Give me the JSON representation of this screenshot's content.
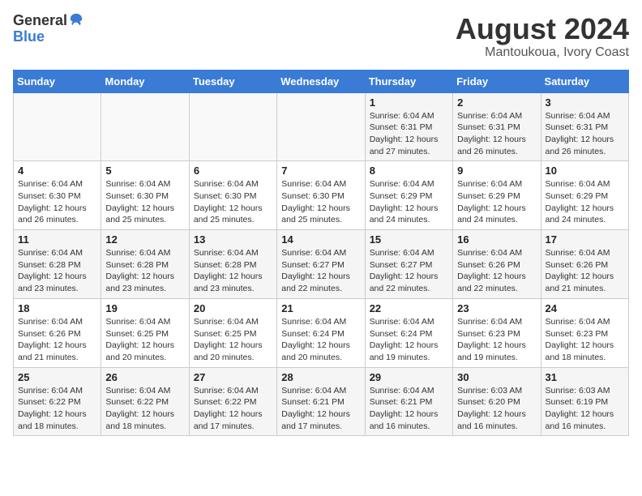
{
  "header": {
    "logo_general": "General",
    "logo_blue": "Blue",
    "month_year": "August 2024",
    "location": "Mantoukoua, Ivory Coast"
  },
  "days_of_week": [
    "Sunday",
    "Monday",
    "Tuesday",
    "Wednesday",
    "Thursday",
    "Friday",
    "Saturday"
  ],
  "weeks": [
    [
      {
        "day": "",
        "info": ""
      },
      {
        "day": "",
        "info": ""
      },
      {
        "day": "",
        "info": ""
      },
      {
        "day": "",
        "info": ""
      },
      {
        "day": "1",
        "info": "Sunrise: 6:04 AM\nSunset: 6:31 PM\nDaylight: 12 hours\nand 27 minutes."
      },
      {
        "day": "2",
        "info": "Sunrise: 6:04 AM\nSunset: 6:31 PM\nDaylight: 12 hours\nand 26 minutes."
      },
      {
        "day": "3",
        "info": "Sunrise: 6:04 AM\nSunset: 6:31 PM\nDaylight: 12 hours\nand 26 minutes."
      }
    ],
    [
      {
        "day": "4",
        "info": "Sunrise: 6:04 AM\nSunset: 6:30 PM\nDaylight: 12 hours\nand 26 minutes."
      },
      {
        "day": "5",
        "info": "Sunrise: 6:04 AM\nSunset: 6:30 PM\nDaylight: 12 hours\nand 25 minutes."
      },
      {
        "day": "6",
        "info": "Sunrise: 6:04 AM\nSunset: 6:30 PM\nDaylight: 12 hours\nand 25 minutes."
      },
      {
        "day": "7",
        "info": "Sunrise: 6:04 AM\nSunset: 6:30 PM\nDaylight: 12 hours\nand 25 minutes."
      },
      {
        "day": "8",
        "info": "Sunrise: 6:04 AM\nSunset: 6:29 PM\nDaylight: 12 hours\nand 24 minutes."
      },
      {
        "day": "9",
        "info": "Sunrise: 6:04 AM\nSunset: 6:29 PM\nDaylight: 12 hours\nand 24 minutes."
      },
      {
        "day": "10",
        "info": "Sunrise: 6:04 AM\nSunset: 6:29 PM\nDaylight: 12 hours\nand 24 minutes."
      }
    ],
    [
      {
        "day": "11",
        "info": "Sunrise: 6:04 AM\nSunset: 6:28 PM\nDaylight: 12 hours\nand 23 minutes."
      },
      {
        "day": "12",
        "info": "Sunrise: 6:04 AM\nSunset: 6:28 PM\nDaylight: 12 hours\nand 23 minutes."
      },
      {
        "day": "13",
        "info": "Sunrise: 6:04 AM\nSunset: 6:28 PM\nDaylight: 12 hours\nand 23 minutes."
      },
      {
        "day": "14",
        "info": "Sunrise: 6:04 AM\nSunset: 6:27 PM\nDaylight: 12 hours\nand 22 minutes."
      },
      {
        "day": "15",
        "info": "Sunrise: 6:04 AM\nSunset: 6:27 PM\nDaylight: 12 hours\nand 22 minutes."
      },
      {
        "day": "16",
        "info": "Sunrise: 6:04 AM\nSunset: 6:26 PM\nDaylight: 12 hours\nand 22 minutes."
      },
      {
        "day": "17",
        "info": "Sunrise: 6:04 AM\nSunset: 6:26 PM\nDaylight: 12 hours\nand 21 minutes."
      }
    ],
    [
      {
        "day": "18",
        "info": "Sunrise: 6:04 AM\nSunset: 6:26 PM\nDaylight: 12 hours\nand 21 minutes."
      },
      {
        "day": "19",
        "info": "Sunrise: 6:04 AM\nSunset: 6:25 PM\nDaylight: 12 hours\nand 20 minutes."
      },
      {
        "day": "20",
        "info": "Sunrise: 6:04 AM\nSunset: 6:25 PM\nDaylight: 12 hours\nand 20 minutes."
      },
      {
        "day": "21",
        "info": "Sunrise: 6:04 AM\nSunset: 6:24 PM\nDaylight: 12 hours\nand 20 minutes."
      },
      {
        "day": "22",
        "info": "Sunrise: 6:04 AM\nSunset: 6:24 PM\nDaylight: 12 hours\nand 19 minutes."
      },
      {
        "day": "23",
        "info": "Sunrise: 6:04 AM\nSunset: 6:23 PM\nDaylight: 12 hours\nand 19 minutes."
      },
      {
        "day": "24",
        "info": "Sunrise: 6:04 AM\nSunset: 6:23 PM\nDaylight: 12 hours\nand 18 minutes."
      }
    ],
    [
      {
        "day": "25",
        "info": "Sunrise: 6:04 AM\nSunset: 6:22 PM\nDaylight: 12 hours\nand 18 minutes."
      },
      {
        "day": "26",
        "info": "Sunrise: 6:04 AM\nSunset: 6:22 PM\nDaylight: 12 hours\nand 18 minutes."
      },
      {
        "day": "27",
        "info": "Sunrise: 6:04 AM\nSunset: 6:22 PM\nDaylight: 12 hours\nand 17 minutes."
      },
      {
        "day": "28",
        "info": "Sunrise: 6:04 AM\nSunset: 6:21 PM\nDaylight: 12 hours\nand 17 minutes."
      },
      {
        "day": "29",
        "info": "Sunrise: 6:04 AM\nSunset: 6:21 PM\nDaylight: 12 hours\nand 16 minutes."
      },
      {
        "day": "30",
        "info": "Sunrise: 6:03 AM\nSunset: 6:20 PM\nDaylight: 12 hours\nand 16 minutes."
      },
      {
        "day": "31",
        "info": "Sunrise: 6:03 AM\nSunset: 6:19 PM\nDaylight: 12 hours\nand 16 minutes."
      }
    ]
  ]
}
